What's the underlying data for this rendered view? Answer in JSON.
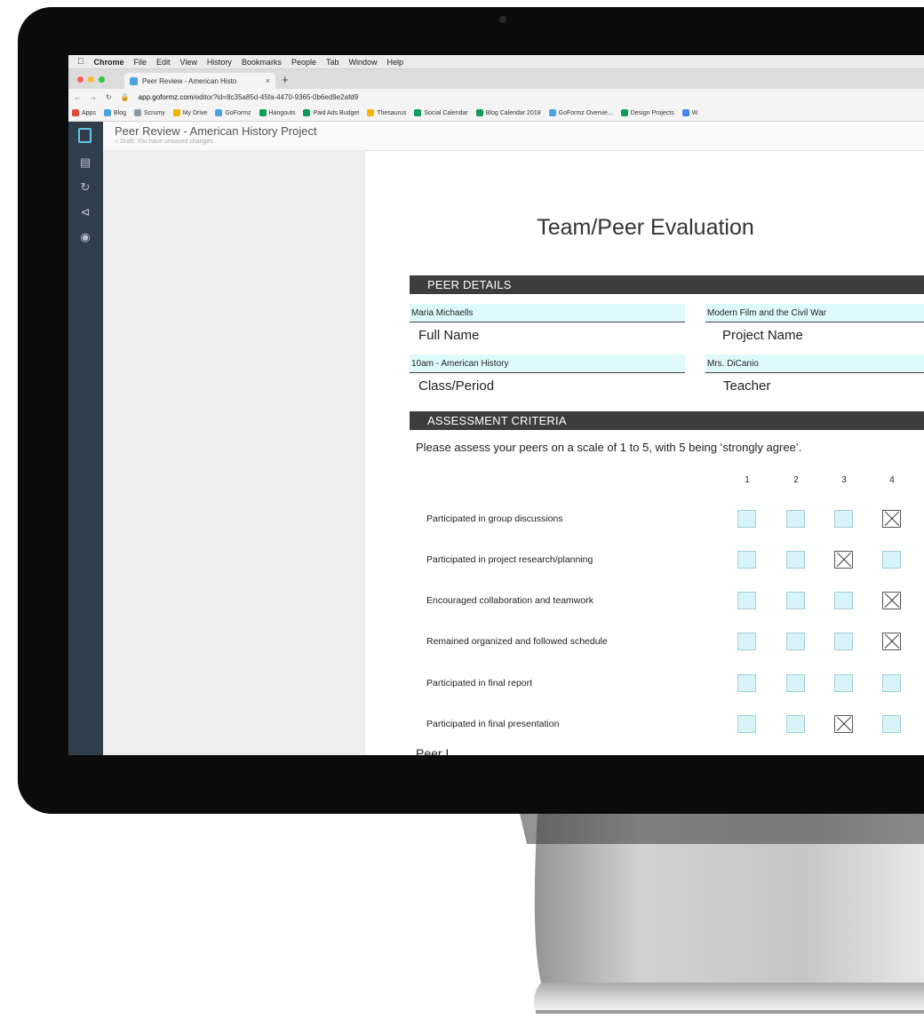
{
  "menubar": {
    "app": "Chrome",
    "items": [
      "File",
      "Edit",
      "View",
      "History",
      "Bookmarks",
      "People",
      "Tab",
      "Window",
      "Help"
    ]
  },
  "browser": {
    "tab_title": "Peer Review - American Histo",
    "tab_close": "×",
    "new_tab": "+",
    "url_host": "app.goformz.com",
    "url_path": "/editor?id=8c35a85d-45fa-4470-9365-0b6ed9e2afd9",
    "bookmarks": [
      {
        "label": "Apps",
        "color": "#e04b3a"
      },
      {
        "label": "Blog",
        "color": "#4aa3df"
      },
      {
        "label": "Scrumy",
        "color": "#8a9aa8"
      },
      {
        "label": "My Drive",
        "color": "#f4b400"
      },
      {
        "label": "GoFormz",
        "color": "#4aa3df"
      },
      {
        "label": "Hangouts",
        "color": "#0f9d58"
      },
      {
        "label": "Paid Ads Budget",
        "color": "#0f9d58"
      },
      {
        "label": "Thesaurus",
        "color": "#f4b400"
      },
      {
        "label": "Social Calendar",
        "color": "#0f9d58"
      },
      {
        "label": "Blog Calendar 2018",
        "color": "#0f9d58"
      },
      {
        "label": "GoFormz Overvie...",
        "color": "#4aa3df"
      },
      {
        "label": "Design Projects",
        "color": "#0f9d58"
      },
      {
        "label": "W",
        "color": "#4285f4"
      }
    ]
  },
  "app": {
    "doc_title": "Peer Review - American History Project",
    "draft_status": "Draft: You have unsaved changes"
  },
  "form": {
    "title": "Team/Peer Evaluation",
    "peer_details_header": "PEER DETAILS",
    "full_name_value": "Maria Michaells",
    "full_name_label": "Full Name",
    "project_value": "Modern Film and the Civil War",
    "project_label": "Project Name",
    "class_value": "10am - American History",
    "class_label": "Class/Period",
    "teacher_value": "Mrs. DiCanio",
    "teacher_label": "Teacher",
    "criteria_header": "ASSESSMENT CRITERIA",
    "instructions": "Please assess your peers on a scale of 1 to 5, with 5 being ‘strongly agree’.",
    "scale": [
      "1",
      "2",
      "3",
      "4"
    ],
    "criteria": [
      {
        "label": "Participated in group discussions",
        "rating": 4
      },
      {
        "label": "Participated in project research/planning",
        "rating": 3
      },
      {
        "label": "Encouraged collaboration and teamwork",
        "rating": 4
      },
      {
        "label": "Remained organized and followed schedule",
        "rating": 4
      },
      {
        "label": "Participated in final report",
        "rating": 0
      },
      {
        "label": "Participated in final presentation",
        "rating": 3
      }
    ],
    "next_section_fragment": "Peer L"
  }
}
